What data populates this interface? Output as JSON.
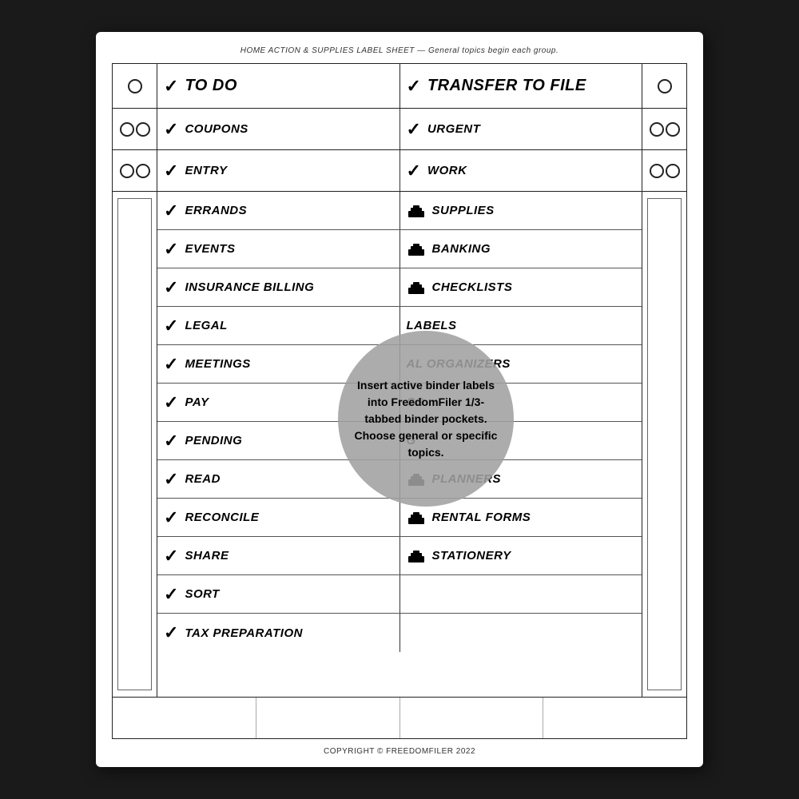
{
  "header": {
    "text": "HOME ACTION & SUPPLIES LABEL SHEET — General topics begin each group."
  },
  "footer": {
    "text": "COPYRIGHT © FREEDOMFILER 2022"
  },
  "tooltip": {
    "text": "Insert active binder labels into FreedomFiler 1/3-tabbed binder pockets. Choose general or specific topics."
  },
  "rows": [
    {
      "left": {
        "icon": "check",
        "label": "TO DO"
      },
      "right": {
        "icon": "check",
        "label": "TRANSFER TO FILE"
      },
      "type": "top-large"
    },
    {
      "left": {
        "icon": "check",
        "label": "COUPONS"
      },
      "right": {
        "icon": "check",
        "label": "URGENT"
      },
      "type": "two-circles"
    },
    {
      "left": {
        "icon": "check",
        "label": "ENTRY"
      },
      "right": {
        "icon": "check",
        "label": "WORK"
      },
      "type": "two-circles"
    },
    {
      "left": {
        "icon": "check",
        "label": "ERRANDS"
      },
      "right": {
        "icon": "tray",
        "label": "SUPPLIES"
      }
    },
    {
      "left": {
        "icon": "check",
        "label": "EVENTS"
      },
      "right": {
        "icon": "tray",
        "label": "BANKING"
      }
    },
    {
      "left": {
        "icon": "check",
        "label": "INSURANCE BILLING"
      },
      "right": {
        "icon": "tray",
        "label": "CHECKLISTS"
      }
    },
    {
      "left": {
        "icon": "check",
        "label": "LEGAL"
      },
      "right": {
        "icon": "none",
        "label": "LABELS"
      }
    },
    {
      "left": {
        "icon": "check",
        "label": "MEETINGS"
      },
      "right": {
        "icon": "none",
        "label": "AL ORGANIZERS"
      }
    },
    {
      "left": {
        "icon": "check",
        "label": "PAY"
      },
      "right": {
        "icon": "none",
        "label": "GS"
      }
    },
    {
      "left": {
        "icon": "check",
        "label": "PENDING"
      },
      "right": {
        "icon": "none",
        "label": "G"
      }
    },
    {
      "left": {
        "icon": "check",
        "label": "READ"
      },
      "right": {
        "icon": "tray",
        "label": "PLANNERS"
      }
    },
    {
      "left": {
        "icon": "check",
        "label": "RECONCILE"
      },
      "right": {
        "icon": "tray",
        "label": "RENTAL FORMS"
      }
    },
    {
      "left": {
        "icon": "check",
        "label": "SHARE"
      },
      "right": {
        "icon": "tray",
        "label": "STATIONERY"
      }
    },
    {
      "left": {
        "icon": "check",
        "label": "SORT"
      },
      "right": null
    },
    {
      "left": {
        "icon": "check",
        "label": "TAX PREPARATION"
      },
      "right": null
    }
  ]
}
